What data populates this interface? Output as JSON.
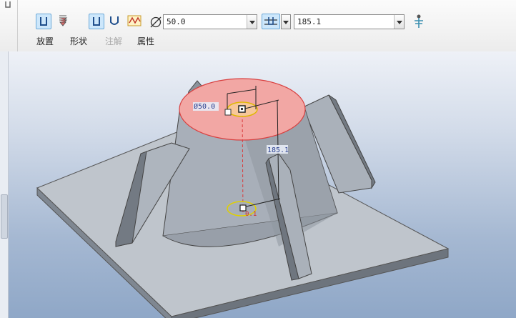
{
  "toolbar": {
    "diameter_value": "50.0",
    "depth_value": "185.1",
    "tabs": [
      "放置",
      "形状",
      "注解",
      "属性"
    ]
  },
  "model": {
    "dim_diameter": "Ø50.0",
    "dim_depth": "185.1",
    "dim_small": "0.1"
  },
  "colors": {
    "selection_fill": "#f2a7a4",
    "dimension_text": "#2a3f8f",
    "surface_gray": "#a8afb9"
  }
}
